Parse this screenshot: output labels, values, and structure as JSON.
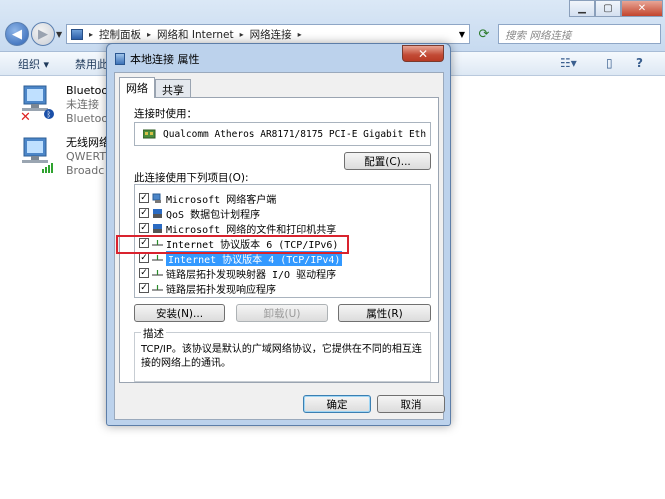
{
  "explorer": {
    "breadcrumbs": [
      "控制面板",
      "网络和 Internet",
      "网络连接"
    ],
    "search_placeholder": "搜索 网络连接",
    "toolbar": {
      "organize": "组织",
      "next": "禁用此"
    },
    "connections": [
      {
        "name": "Bluetoo",
        "status": "未连接",
        "detail": "Bluetoo"
      },
      {
        "name": "无线网络",
        "status": "QWERT",
        "detail": "Broadc"
      }
    ]
  },
  "dialog": {
    "title": "本地连接 属性",
    "close": "✕",
    "tabs": [
      {
        "label": "网络"
      },
      {
        "label": "共享"
      }
    ],
    "connect_using_label": "连接时使用：",
    "adapter": "Qualcomm Atheros AR8171/8175 PCI-E Gigabit Eth",
    "configure_button": "配置(C)...",
    "items_label": "此连接使用下列项目(O):",
    "items": [
      {
        "label": "Microsoft 网络客户端",
        "icon": "network-client-icon"
      },
      {
        "label": "QoS 数据包计划程序",
        "icon": "qos-icon"
      },
      {
        "label": "Microsoft 网络的文件和打印机共享",
        "icon": "file-share-icon"
      },
      {
        "label": "Internet 协议版本 6 (TCP/IPv6)",
        "icon": "protocol-icon"
      },
      {
        "label": "Internet 协议版本 4 (TCP/IPv4)",
        "icon": "protocol-icon"
      },
      {
        "label": "链路层拓扑发现映射器 I/O 驱动程序",
        "icon": "protocol-icon"
      },
      {
        "label": "链路层拓扑发现响应程序",
        "icon": "protocol-icon"
      }
    ],
    "check_mark": "✓",
    "install_button": "安装(N)...",
    "uninstall_button": "卸载(U)",
    "properties_button": "属性(R)",
    "description_label": "描述",
    "description": "TCP/IP。该协议是默认的广域网络协议，它提供在不同的相互连接的网络上的通讯。",
    "ok_button": "确定",
    "cancel_button": "取消"
  }
}
